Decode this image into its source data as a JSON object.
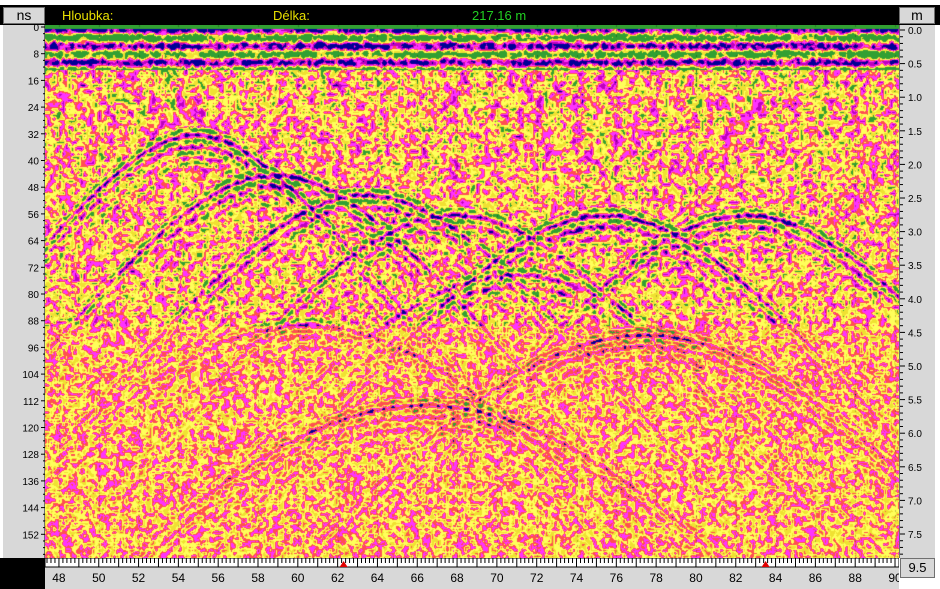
{
  "header": {
    "depth_axis_unit": "ns",
    "depth_unit_right": "m",
    "depth_label": "Hloubka:",
    "length_label": "Délka:",
    "length_value": "217.16 m"
  },
  "colors": {
    "header_label": "#e8e000",
    "length_value": "#22d022",
    "marker": "#e00000",
    "palette": [
      "#ffff55",
      "#f0e030",
      "#ff5050",
      "#ff30ff",
      "#c000c0",
      "#0000a0",
      "#30a030"
    ]
  },
  "left_axis": {
    "labels": [
      "0",
      "8",
      "16",
      "24",
      "32",
      "40",
      "48",
      "56",
      "64",
      "72",
      "80",
      "88",
      "96",
      "104",
      "112",
      "120",
      "128",
      "136",
      "144",
      "152"
    ]
  },
  "right_axis": {
    "labels": [
      "0.0",
      "0.5",
      "1.0",
      "1.5",
      "2.0",
      "2.5",
      "3.0",
      "3.5",
      "4.0",
      "4.5",
      "5.0",
      "5.5",
      "6.0",
      "6.5",
      "7.0",
      "7.5"
    ]
  },
  "bottom_axis": {
    "labels": [
      "48",
      "50",
      "52",
      "54",
      "56",
      "58",
      "60",
      "62",
      "64",
      "66",
      "68",
      "70",
      "72",
      "74",
      "76",
      "78",
      "80",
      "82",
      "84",
      "86",
      "88",
      "90"
    ],
    "range": [
      47.3,
      90.2
    ],
    "markers": [
      62.3,
      83.5
    ]
  },
  "scroll_value": "9.5"
}
